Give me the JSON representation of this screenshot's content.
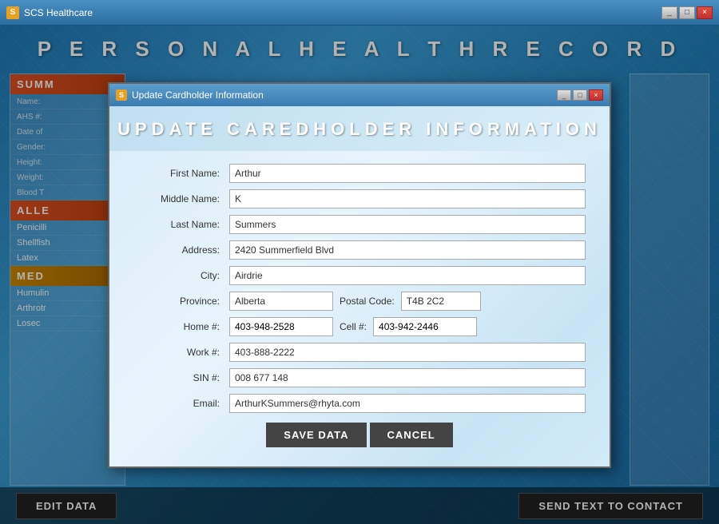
{
  "outer_window": {
    "title": "SCS Healthcare",
    "icon_text": "S",
    "controls": [
      "_",
      "□",
      "×"
    ]
  },
  "header": {
    "text": "P E R S O N A L   H E A L T H   R E C O R D"
  },
  "left_panel": {
    "summary_header": "SUMM",
    "name_label": "Name:",
    "ahs_label": "AHS #:",
    "dob_label": "Date of",
    "gender_label": "Gender:",
    "height_label": "Height:",
    "weight_label": "Weight:",
    "blood_label": "Blood T",
    "allergies_header": "ALLE",
    "allergy1": "Penicilli",
    "allergy2": "Shellfish",
    "allergy3": "Latex",
    "meds_header": "MED",
    "med1": "Humulin",
    "med2": "Arthrotr",
    "med3": "Losec"
  },
  "bottom_bar": {
    "edit_btn": "EDIT DATA",
    "send_btn": "SEND TEXT TO CONTACT"
  },
  "modal": {
    "title": "Update Cardholder Information",
    "icon_text": "S",
    "header_text": "UPDATE CAREDHOLDER INFORMATION",
    "controls": [
      "_",
      "□",
      "×"
    ],
    "form": {
      "first_name_label": "First Name:",
      "first_name_value": "Arthur",
      "middle_name_label": "Middle Name:",
      "middle_name_value": "K",
      "last_name_label": "Last Name:",
      "last_name_value": "Summers",
      "address_label": "Address:",
      "address_value": "2420 Summerfield Blvd",
      "city_label": "City:",
      "city_value": "Airdrie",
      "province_label": "Province:",
      "province_value": "Alberta",
      "postal_code_label": "Postal Code:",
      "postal_code_value": "T4B 2C2",
      "home_label": "Home #:",
      "home_value": "403-948-2528",
      "cell_label": "Cell #:",
      "cell_value": "403-942-2446",
      "work_label": "Work #:",
      "work_value": "403-888-2222",
      "sin_label": "SIN #:",
      "sin_value": "008 677 148",
      "email_label": "Email:",
      "email_value": "ArthurKSummers@rhyta.com"
    },
    "save_btn": "SAVE DATA",
    "cancel_btn": "CANCEL"
  }
}
